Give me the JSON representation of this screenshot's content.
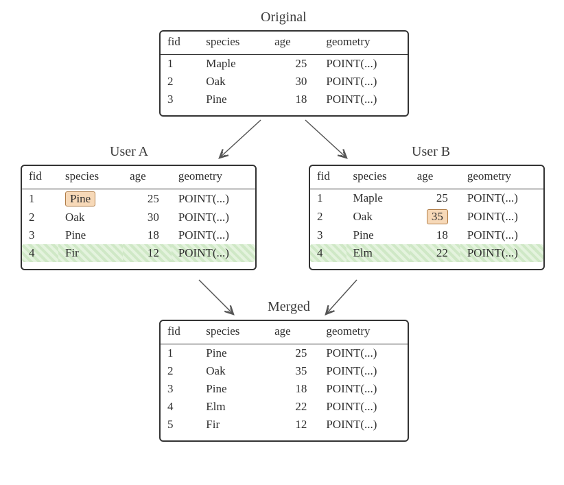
{
  "labels": {
    "original": "Original",
    "userA": "User A",
    "userB": "User B",
    "merged": "Merged"
  },
  "headers": {
    "fid": "fid",
    "species": "species",
    "age": "age",
    "geometry": "geometry"
  },
  "tables": {
    "original": [
      {
        "fid": "1",
        "species": "Maple",
        "age": "25",
        "geometry": "POINT(...)"
      },
      {
        "fid": "2",
        "species": "Oak",
        "age": "30",
        "geometry": "POINT(...)"
      },
      {
        "fid": "3",
        "species": "Pine",
        "age": "18",
        "geometry": "POINT(...)"
      }
    ],
    "userA": [
      {
        "fid": "1",
        "species": "Pine",
        "age": "25",
        "geometry": "POINT(...)",
        "hlSpecies": true
      },
      {
        "fid": "2",
        "species": "Oak",
        "age": "30",
        "geometry": "POINT(...)"
      },
      {
        "fid": "3",
        "species": "Pine",
        "age": "18",
        "geometry": "POINT(...)"
      },
      {
        "fid": "4",
        "species": "Fir",
        "age": "12",
        "geometry": "POINT(...)",
        "hlRow": true
      }
    ],
    "userB": [
      {
        "fid": "1",
        "species": "Maple",
        "age": "25",
        "geometry": "POINT(...)"
      },
      {
        "fid": "2",
        "species": "Oak",
        "age": "35",
        "geometry": "POINT(...)",
        "hlAge": true
      },
      {
        "fid": "3",
        "species": "Pine",
        "age": "18",
        "geometry": "POINT(...)"
      },
      {
        "fid": "4",
        "species": "Elm",
        "age": "22",
        "geometry": "POINT(...)",
        "hlRow": true
      }
    ],
    "merged": [
      {
        "fid": "1",
        "species": "Pine",
        "age": "25",
        "geometry": "POINT(...)"
      },
      {
        "fid": "2",
        "species": "Oak",
        "age": "35",
        "geometry": "POINT(...)"
      },
      {
        "fid": "3",
        "species": "Pine",
        "age": "18",
        "geometry": "POINT(...)"
      },
      {
        "fid": "4",
        "species": "Elm",
        "age": "22",
        "geometry": "POINT(...)"
      },
      {
        "fid": "5",
        "species": "Fir",
        "age": "12",
        "geometry": "POINT(...)"
      }
    ]
  }
}
